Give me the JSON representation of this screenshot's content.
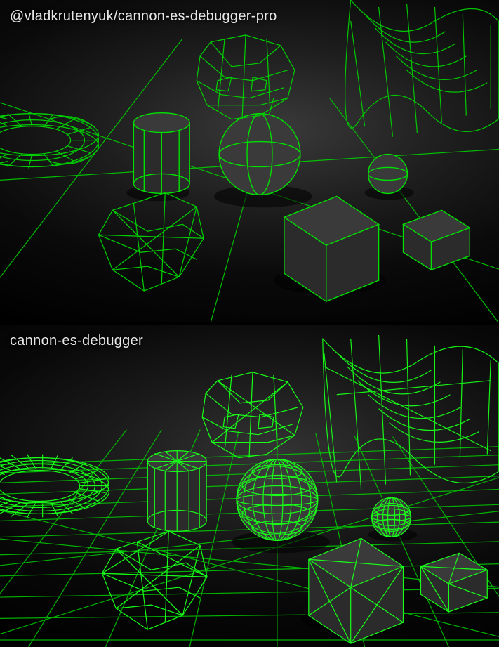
{
  "panels": {
    "top": {
      "label": "@vladkrutenyuk/cannon-es-debugger-pro"
    },
    "bottom": {
      "label": "cannon-es-debugger"
    }
  },
  "colors": {
    "wireframe": "#00d000",
    "wireframeBright": "#18ff18",
    "background": "#000000",
    "solidDark": "#3a3a3a",
    "solidDarker": "#2b2b2b"
  },
  "scene": {
    "shapes": [
      {
        "type": "torus",
        "name": "torus"
      },
      {
        "type": "cylinder",
        "name": "cylinder"
      },
      {
        "type": "sphere",
        "name": "sphere-large"
      },
      {
        "type": "sphere",
        "name": "sphere-small"
      },
      {
        "type": "box",
        "name": "box-large"
      },
      {
        "type": "box",
        "name": "box-small"
      },
      {
        "type": "convexhull",
        "name": "skull"
      },
      {
        "type": "convexhull",
        "name": "crystal"
      },
      {
        "type": "heightfield",
        "name": "terrain-wave"
      },
      {
        "type": "plane",
        "name": "ground-plane"
      }
    ]
  }
}
